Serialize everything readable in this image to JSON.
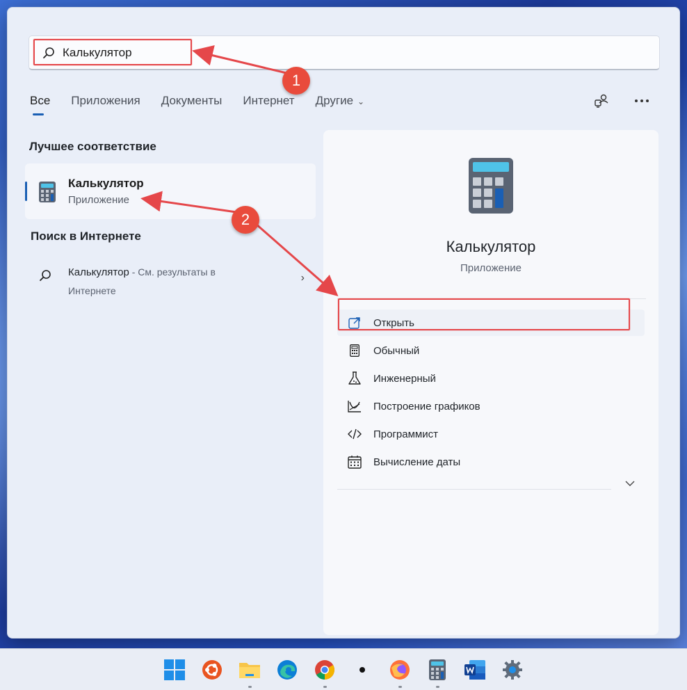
{
  "search": {
    "value": "Калькулятор"
  },
  "tabs": [
    {
      "label": "Все",
      "active": true
    },
    {
      "label": "Приложения"
    },
    {
      "label": "Документы"
    },
    {
      "label": "Интернет"
    },
    {
      "label": "Другие"
    }
  ],
  "sections": {
    "best_match": "Лучшее соответствие",
    "web_search": "Поиск в Интернете"
  },
  "best_match": {
    "name": "Калькулятор",
    "type": "Приложение"
  },
  "web_result": {
    "query": "Калькулятор",
    "suffix": " - См. результаты в",
    "suffix2": "Интернете"
  },
  "detail": {
    "title": "Калькулятор",
    "subtitle": "Приложение",
    "actions": [
      {
        "label": "Открыть",
        "icon": "open-external-icon"
      },
      {
        "label": "Обычный",
        "icon": "calculator-icon"
      },
      {
        "label": "Инженерный",
        "icon": "flask-icon"
      },
      {
        "label": "Построение графиков",
        "icon": "graph-icon"
      },
      {
        "label": "Программист",
        "icon": "code-icon"
      },
      {
        "label": "Вычисление даты",
        "icon": "calendar-icon"
      }
    ]
  },
  "annotations": {
    "badge1": "1",
    "badge2": "2"
  },
  "taskbar": [
    "windows-start-icon",
    "ubuntu-icon",
    "file-explorer-icon",
    "edge-icon",
    "chrome-icon",
    "dot-app-icon",
    "firefox-icon",
    "calculator-icon",
    "word-icon",
    "settings-icon"
  ],
  "colors": {
    "accent": "#1a5fb4",
    "annotation": "#e5474a"
  }
}
